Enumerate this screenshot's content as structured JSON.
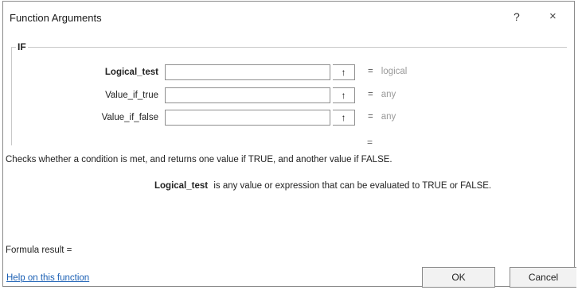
{
  "window": {
    "title": "Function Arguments",
    "help_label": "?",
    "close_label": "×"
  },
  "function": {
    "name": "IF"
  },
  "arguments": [
    {
      "label": "Logical_test",
      "value": "",
      "result": "logical",
      "ref_icon": "↑"
    },
    {
      "label": "Value_if_true",
      "value": "",
      "result": "any",
      "ref_icon": "↑"
    },
    {
      "label": "Value_if_false",
      "value": "",
      "result": "any",
      "ref_icon": "↑"
    }
  ],
  "function_result_dash": "=",
  "description": "Checks whether a condition is met, and returns one value if TRUE, and another value if FALSE.",
  "argument_description": {
    "name": "Logical_test",
    "text": "is any value or expression that can be evaluated to TRUE or FALSE."
  },
  "formula_result": "Formula result =",
  "help_link": "Help on this function",
  "buttons": {
    "ok": "OK",
    "cancel": "Cancel"
  },
  "icons": {
    "ref": "collapse-dialog-icon",
    "help": "question-icon",
    "close": "close-icon"
  }
}
